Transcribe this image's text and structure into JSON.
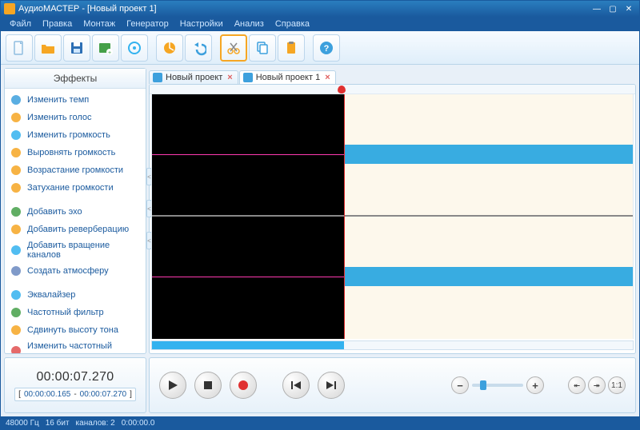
{
  "app": {
    "title": "АудиоМАСТЕР - [Новый проект 1]"
  },
  "menu": [
    "Файл",
    "Правка",
    "Монтаж",
    "Генератор",
    "Настройки",
    "Анализ",
    "Справка"
  ],
  "toolbar": [
    {
      "name": "new-file-icon",
      "color": "#8fbde0"
    },
    {
      "name": "open-file-icon",
      "color": "#f6a623"
    },
    {
      "name": "save-icon",
      "color": "#2d6fb5"
    },
    {
      "name": "add-media-icon",
      "color": "#45a049"
    },
    {
      "name": "burn-cd-icon",
      "color": "#33b2ef"
    },
    {
      "sep": true
    },
    {
      "name": "mixer-icon",
      "color": "#f6a623"
    },
    {
      "name": "undo-icon",
      "color": "#3da0dd"
    },
    {
      "sep": true
    },
    {
      "name": "cut-icon",
      "color": "#f6a623",
      "selected": true
    },
    {
      "name": "copy-icon",
      "color": "#3da0dd"
    },
    {
      "name": "paste-icon",
      "color": "#f6a623"
    },
    {
      "sep": true
    },
    {
      "name": "help-icon",
      "color": "#3da0dd"
    }
  ],
  "sidebar": {
    "header": "Эффекты",
    "groups": [
      [
        {
          "label": "Изменить темп",
          "icon": "clock-icon",
          "color": "#3da0dd"
        },
        {
          "label": "Изменить голос",
          "icon": "person-icon",
          "color": "#f6a623"
        },
        {
          "label": "Изменить громкость",
          "icon": "volume-icon",
          "color": "#33b2ef"
        },
        {
          "label": "Выровнять громкость",
          "icon": "level-icon",
          "color": "#f6a623"
        },
        {
          "label": "Возрастание громкости",
          "icon": "fadein-icon",
          "color": "#f6a623"
        },
        {
          "label": "Затухание громкости",
          "icon": "fadeout-icon",
          "color": "#f6a623"
        }
      ],
      [
        {
          "label": "Добавить эхо",
          "icon": "echo-icon",
          "color": "#45a049"
        },
        {
          "label": "Добавить реверберацию",
          "icon": "reverb-icon",
          "color": "#f6a623"
        },
        {
          "label": "Добавить вращение каналов",
          "icon": "rotate-icon",
          "color": "#33b2ef"
        },
        {
          "label": "Создать атмосферу",
          "icon": "atmosphere-icon",
          "color": "#6a88c0"
        }
      ],
      [
        {
          "label": "Эквалайзер",
          "icon": "eq-icon",
          "color": "#33b2ef"
        },
        {
          "label": "Частотный фильтр",
          "icon": "filter-icon",
          "color": "#45a049"
        },
        {
          "label": "Сдвинуть высоту тона",
          "icon": "pitch-icon",
          "color": "#f6a623"
        },
        {
          "label": "Изменить частотный спектр",
          "icon": "spectrum-icon",
          "color": "#e05050"
        }
      ]
    ]
  },
  "tabs": [
    {
      "label": "Новый проект",
      "active": false
    },
    {
      "label": "Новый проект 1",
      "active": true
    }
  ],
  "time": {
    "current": "00:00:07.270",
    "sel_start": "00:00:00.165",
    "sel_end": "00:00:07.270",
    "sep": "-"
  },
  "status": {
    "sample_rate": "48000 Гц",
    "bit_depth": "16 бит",
    "channels": "каналов: 2",
    "duration": "0:00:00.0"
  },
  "nav": {
    "fit": "1:1"
  }
}
